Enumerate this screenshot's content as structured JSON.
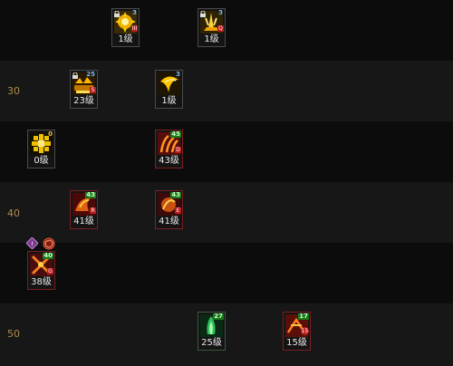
{
  "levels": [
    "30",
    "40",
    "50"
  ],
  "skills": [
    {
      "id": "s1",
      "label": "1级",
      "badge": "3",
      "corner": "III"
    },
    {
      "id": "s2",
      "label": "1级",
      "badge": "3",
      "corner": "Q"
    },
    {
      "id": "s3",
      "label": "23级",
      "badge": "25",
      "corner": "S"
    },
    {
      "id": "s4",
      "label": "1级",
      "badge": "3",
      "corner": ""
    },
    {
      "id": "s5",
      "label": "0级",
      "badge": "0",
      "corner": ""
    },
    {
      "id": "s6",
      "label": "43级",
      "badge": "45",
      "corner": "D"
    },
    {
      "id": "s7",
      "label": "41级",
      "badge": "43",
      "corner": "R"
    },
    {
      "id": "s8",
      "label": "41级",
      "badge": "43",
      "corner": "E"
    },
    {
      "id": "s9",
      "label": "38级",
      "badge": "40",
      "corner": "G"
    },
    {
      "id": "s10",
      "label": "25级",
      "badge": "27",
      "corner": ""
    },
    {
      "id": "s11",
      "label": "15级",
      "badge": "17",
      "corner": "15"
    }
  ],
  "icons": [
    "lock-icon",
    "sun-burst-icon",
    "flame-pillar-icon",
    "meteor-icon",
    "fireball-icon",
    "flower-icon",
    "claw-flame-icon",
    "dragon-flame-icon",
    "crossed-flame-icon",
    "green-fire-icon",
    "phoenix-icon",
    "purple-rune-icon",
    "spiral-rune-icon"
  ],
  "colors": {
    "level_text": "#b08a4a",
    "badge_blue": "#6fb6ff",
    "badge_green": "#1a7a1a"
  }
}
